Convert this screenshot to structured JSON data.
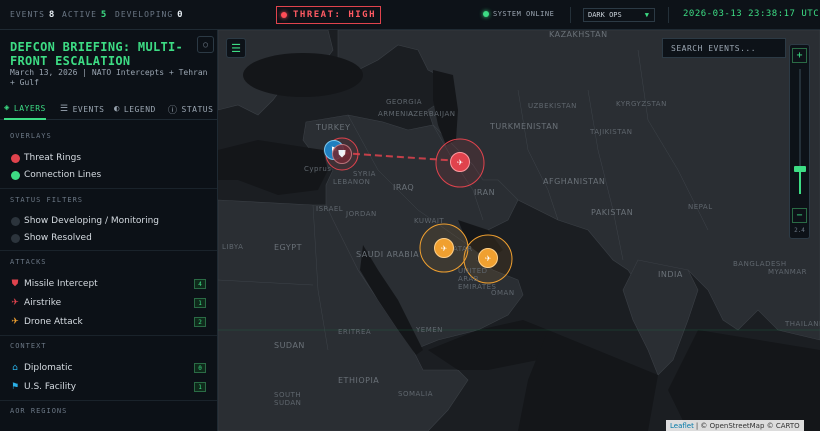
{
  "topbar": {
    "events_label": "EVENTS",
    "events_count": "8",
    "active_label": "ACTIVE",
    "active_count": "5",
    "developing_label": "DEVELOPING",
    "developing_count": "0",
    "threat_label": "THREAT: HIGH",
    "system_status": "SYSTEM ONLINE",
    "theme_select": "DARK OPS",
    "clock": "2026-03-13 23:38:17 UTC"
  },
  "sidebar": {
    "title": "DEFCON BRIEFING: MULTI-FRONT ESCALATION",
    "subtitle": "March 13, 2026 | NATO Intercepts + Tehran + Gulf",
    "tabs": [
      {
        "label": "LAYERS",
        "icon": "layers-icon"
      },
      {
        "label": "EVENTS",
        "icon": "list-icon"
      },
      {
        "label": "LEGEND",
        "icon": "palette-icon"
      },
      {
        "label": "STATUS",
        "icon": "info-icon"
      }
    ],
    "sections": {
      "overlays": "OVERLAYS",
      "status_filters": "STATUS FILTERS",
      "attacks": "ATTACKS",
      "context": "CONTEXT",
      "aor": "AOR REGIONS"
    },
    "overlays": [
      {
        "label": "Threat Rings",
        "color": "#e0434d"
      },
      {
        "label": "Connection Lines",
        "color": "#3ddc84"
      }
    ],
    "status_filters": [
      {
        "label": "Show Developing / Monitoring"
      },
      {
        "label": "Show Resolved"
      }
    ],
    "attacks": [
      {
        "label": "Missile Intercept",
        "count": "4",
        "color": "#e0434d"
      },
      {
        "label": "Airstrike",
        "count": "1",
        "color": "#e0434d"
      },
      {
        "label": "Drone Attack",
        "count": "2",
        "color": "#f0a030"
      }
    ],
    "context": [
      {
        "label": "Diplomatic",
        "count": "0",
        "color": "#2ab0e8"
      },
      {
        "label": "U.S. Facility",
        "count": "1",
        "color": "#2ab0e8"
      }
    ]
  },
  "map": {
    "search_placeholder": "SEARCH EVENTS...",
    "zoom_level": "2.4",
    "zoom_fraction": 0.2,
    "attribution_link": "Leaflet",
    "attribution_text": "| © OpenStreetMap © CARTO",
    "labels": {
      "kazakhstan": "KAZAKHSTAN",
      "uzbekistan": "UZBEKISTAN",
      "kyrgyzstan": "KYRGYZSTAN",
      "tajikistan": "TAJIKISTAN",
      "turkmenistan": "TURKMENISTAN",
      "afghanistan": "AFGHANISTAN",
      "pakistan": "PAKISTAN",
      "india": "INDIA",
      "nepal": "NEPAL",
      "bangladesh": "BANGLADESH",
      "myanmar": "MYANMAR",
      "thailand": "THAILAND",
      "georgia": "GEORGIA",
      "armenia": "ARMENIA",
      "azerbaijan": "AZERBAIJAN",
      "turkey": "TURKEY",
      "syria": "SYRIA",
      "lebanon": "LEBANON",
      "cyprus": "Cyprus",
      "iraq": "IRAQ",
      "iran": "IRAN",
      "israel": "ISRAEL",
      "jordan": "JORDAN",
      "kuwait": "KUWAIT",
      "qatar": "QATAR",
      "saudi": "SAUDI ARABIA",
      "uae": "UNITED ARAB EMIRATES",
      "oman": "OMAN",
      "egypt": "EGYPT",
      "libya": "LIBYA",
      "sudan": "SUDAN",
      "eritrea": "ERITREA",
      "yemen": "YEMEN",
      "ethiopia": "ETHIOPIA",
      "somalia": "SOMALIA",
      "south_sudan": "SOUTH SUDAN"
    }
  }
}
